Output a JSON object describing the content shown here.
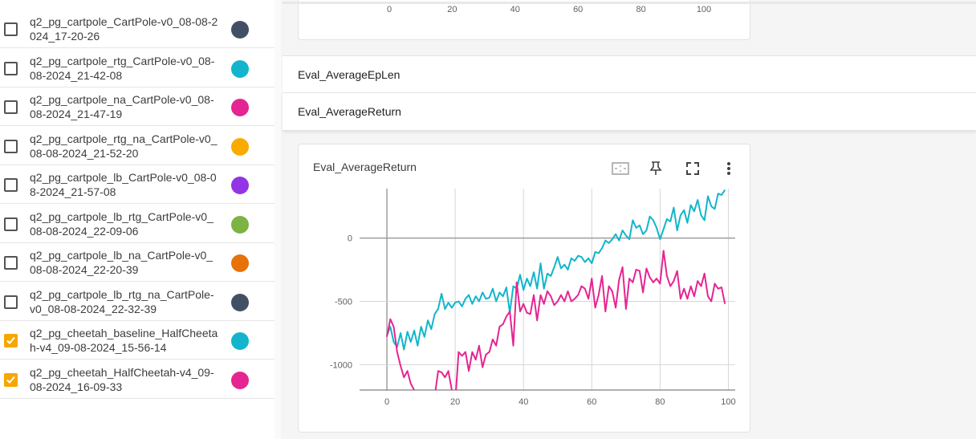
{
  "runs": [
    {
      "name": "q2_pg_cartpole_CartPole-v0_08-08-2024_17-20-26",
      "color": "#425066",
      "checked": false
    },
    {
      "name": "q2_pg_cartpole_rtg_CartPole-v0_08-08-2024_21-42-08",
      "color": "#12b5cb",
      "checked": false
    },
    {
      "name": "q2_pg_cartpole_na_CartPole-v0_08-08-2024_21-47-19",
      "color": "#e52592",
      "checked": false
    },
    {
      "name": "q2_pg_cartpole_rtg_na_CartPole-v0_08-08-2024_21-52-20",
      "color": "#f9ab00",
      "checked": false
    },
    {
      "name": "q2_pg_cartpole_lb_CartPole-v0_08-08-2024_21-57-08",
      "color": "#9334e6",
      "checked": false
    },
    {
      "name": "q2_pg_cartpole_lb_rtg_CartPole-v0_08-08-2024_22-09-06",
      "color": "#7cb342",
      "checked": false
    },
    {
      "name": "q2_pg_cartpole_lb_na_CartPole-v0_08-08-2024_22-20-39",
      "color": "#e8710a",
      "checked": false
    },
    {
      "name": "q2_pg_cartpole_lb_rtg_na_CartPole-v0_08-08-2024_22-32-39",
      "color": "#425066",
      "checked": false
    },
    {
      "name": "q2_pg_cheetah_baseline_HalfCheetah-v4_09-08-2024_15-56-14",
      "color": "#12b5cb",
      "checked": true
    },
    {
      "name": "q2_pg_cheetah_HalfCheetah-v4_09-08-2024_16-09-33",
      "color": "#e52592",
      "checked": true
    }
  ],
  "top_card": {
    "x_ticks": [
      "0",
      "20",
      "40",
      "60",
      "80",
      "100"
    ]
  },
  "groups": {
    "epLen": "Eval_AverageEpLen",
    "return": "Eval_AverageReturn"
  },
  "chart_card": {
    "title": "Eval_AverageReturn",
    "icons": [
      "fit-domain-icon",
      "pin-icon",
      "fullscreen-icon",
      "more-vert-icon"
    ]
  },
  "chart_data": {
    "type": "line",
    "title": "Eval_AverageReturn",
    "xlim": [
      -8,
      102
    ],
    "ylim": [
      -1200,
      390
    ],
    "x_ticks": [
      0,
      20,
      40,
      60,
      80,
      100
    ],
    "y_ticks": [
      0,
      -500,
      -1000
    ],
    "y_tick_labels": [
      "0",
      "-500",
      "-1000"
    ],
    "x_tick_labels": [
      "0",
      "20",
      "40",
      "60",
      "80",
      "100"
    ],
    "grid": true,
    "series": [
      {
        "name": "q2_pg_cheetah_baseline_HalfCheetah-v4_09-08-2024_15-56-14",
        "color": "#12b5cb",
        "x": [
          0,
          1,
          2,
          3,
          4,
          5,
          6,
          7,
          8,
          9,
          10,
          11,
          12,
          13,
          14,
          15,
          16,
          17,
          18,
          19,
          20,
          21,
          22,
          23,
          24,
          25,
          26,
          27,
          28,
          29,
          30,
          31,
          32,
          33,
          34,
          35,
          36,
          37,
          38,
          39,
          40,
          41,
          42,
          43,
          44,
          45,
          46,
          47,
          48,
          49,
          50,
          51,
          52,
          53,
          54,
          55,
          56,
          57,
          58,
          59,
          60,
          61,
          62,
          63,
          64,
          65,
          66,
          67,
          68,
          69,
          70,
          71,
          72,
          73,
          74,
          75,
          76,
          77,
          78,
          79,
          80,
          81,
          82,
          83,
          84,
          85,
          86,
          87,
          88,
          89,
          90,
          91,
          92,
          93,
          94,
          95,
          96,
          97,
          98,
          99
        ],
        "y": [
          -770,
          -700,
          -820,
          -860,
          -750,
          -880,
          -740,
          -820,
          -730,
          -850,
          -700,
          -780,
          -650,
          -720,
          -600,
          -560,
          -440,
          -560,
          -510,
          -550,
          -510,
          -500,
          -540,
          -480,
          -450,
          -520,
          -460,
          -500,
          -430,
          -480,
          -470,
          -400,
          -500,
          -430,
          -460,
          -390,
          -590,
          -380,
          -400,
          -290,
          -410,
          -320,
          -380,
          -270,
          -400,
          -200,
          -400,
          -280,
          -300,
          -230,
          -150,
          -240,
          -210,
          -250,
          -160,
          -180,
          -140,
          -150,
          -190,
          -160,
          -200,
          -110,
          -120,
          -80,
          -20,
          -40,
          -10,
          30,
          -20,
          60,
          20,
          -10,
          140,
          80,
          100,
          30,
          60,
          170,
          140,
          80,
          -10,
          70,
          150,
          130,
          240,
          60,
          180,
          220,
          120,
          260,
          210,
          300,
          180,
          140,
          330,
          250,
          230,
          350,
          340,
          380
        ]
      },
      {
        "name": "q2_pg_cheetah_HalfCheetah-v4_09-08-2024_16-09-33",
        "color": "#e52592",
        "x": [
          0,
          1,
          2,
          3,
          4,
          5,
          6,
          7,
          8,
          9,
          10,
          11,
          12,
          13,
          14,
          15,
          16,
          17,
          18,
          19,
          20,
          21,
          22,
          23,
          24,
          25,
          26,
          27,
          28,
          29,
          30,
          31,
          32,
          33,
          34,
          35,
          36,
          37,
          38,
          39,
          40,
          41,
          42,
          43,
          44,
          45,
          46,
          47,
          48,
          49,
          50,
          51,
          52,
          53,
          54,
          55,
          56,
          57,
          58,
          59,
          60,
          61,
          62,
          63,
          64,
          65,
          66,
          67,
          68,
          69,
          70,
          71,
          72,
          73,
          74,
          75,
          76,
          77,
          78,
          79,
          80,
          81,
          82,
          83,
          84,
          85,
          86,
          87,
          88,
          89,
          90,
          91,
          92,
          93,
          94,
          95,
          96,
          97,
          98,
          99
        ],
        "y": [
          -780,
          -640,
          -700,
          -900,
          -1010,
          -1100,
          -1050,
          -1150,
          -1200,
          -1210,
          -1210,
          -1250,
          -1230,
          -1250,
          -1250,
          -1050,
          -1060,
          -1100,
          -1050,
          -1200,
          -1300,
          -900,
          -930,
          -900,
          -1050,
          -900,
          -960,
          -850,
          -1020,
          -920,
          -900,
          -800,
          -850,
          -700,
          -680,
          -620,
          -580,
          -850,
          -350,
          -580,
          -520,
          -590,
          -600,
          -450,
          -650,
          -450,
          -520,
          -420,
          -460,
          -530,
          -500,
          -450,
          -500,
          -420,
          -500,
          -480,
          -450,
          -380,
          -400,
          -480,
          -320,
          -550,
          -450,
          -300,
          -580,
          -380,
          -420,
          -550,
          -330,
          -230,
          -560,
          -320,
          -350,
          -250,
          -260,
          -430,
          -240,
          -310,
          -350,
          -320,
          -360,
          -100,
          -300,
          -380,
          -340,
          -260,
          -480,
          -400,
          -480,
          -380,
          -460,
          -340,
          -380,
          -280,
          -460,
          -500,
          -360,
          -400,
          -390,
          -520
        ]
      }
    ]
  }
}
